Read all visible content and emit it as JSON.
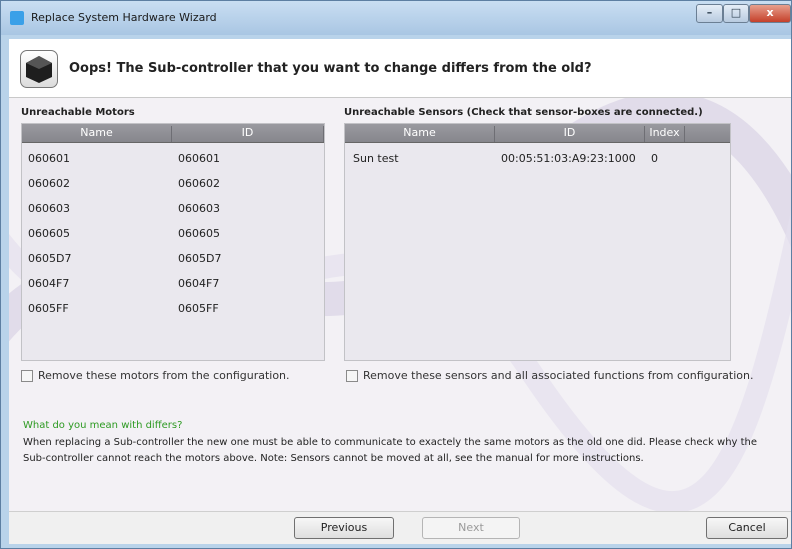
{
  "window": {
    "title": "Replace System Hardware Wizard"
  },
  "title_controls": {
    "minimize": "–",
    "maximize": "□",
    "close": "x"
  },
  "header": {
    "title": "Oops! The Sub-controller that you want to change differs from the old?"
  },
  "motors": {
    "label": "Unreachable Motors",
    "columns": [
      "Name",
      "ID"
    ],
    "rows": [
      [
        "060601",
        "060601"
      ],
      [
        "060602",
        "060602"
      ],
      [
        "060603",
        "060603"
      ],
      [
        "060605",
        "060605"
      ],
      [
        "0605D7",
        "0605D7"
      ],
      [
        "0604F7",
        "0604F7"
      ],
      [
        "0605FF",
        "0605FF"
      ]
    ],
    "remove_label": "Remove these motors from the configuration."
  },
  "sensors": {
    "label": "Unreachable Sensors (Check that sensor-boxes are connected.)",
    "columns": [
      "Name",
      "ID",
      "Index"
    ],
    "rows": [
      [
        "Sun test",
        "00:05:51:03:A9:23:1000",
        "0"
      ]
    ],
    "remove_label": "Remove these sensors and all associated functions from configuration."
  },
  "info": {
    "title": "What do you mean with differs?",
    "text": "When replacing a Sub-controller the new one must be able to communicate to exactely the same motors as the old one did. Please check why the Sub-controller cannot reach the motors above. Note: Sensors cannot be moved at all, see the manual for more instructions."
  },
  "footer": {
    "previous": "Previous",
    "next": "Next",
    "cancel": "Cancel"
  },
  "colors": {
    "title_bar": "#b9d3ea",
    "info_green": "#2d9a22",
    "grid_header": "#8f8f95"
  },
  "icons": {
    "app": "app-icon",
    "header": "cube-icon"
  }
}
